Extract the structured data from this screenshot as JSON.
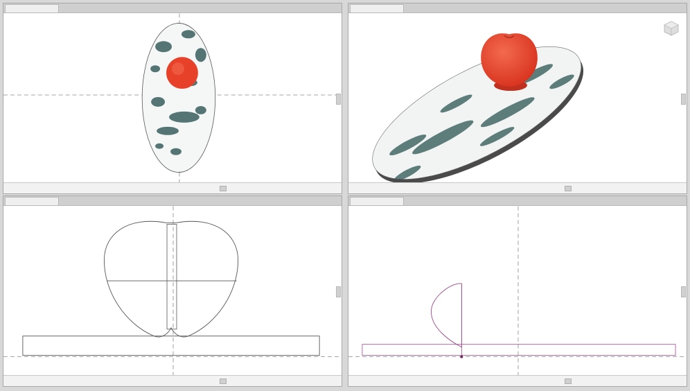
{
  "app": {
    "accent_color": "#e8412a"
  },
  "viewports": [
    {
      "id": "top",
      "tab_label": "",
      "status_tools": "",
      "status_end": ""
    },
    {
      "id": "perspective",
      "tab_label": "",
      "status_tools": "",
      "status_end": ""
    },
    {
      "id": "front",
      "tab_label": "",
      "status_tools": "",
      "status_end": ""
    },
    {
      "id": "right",
      "tab_label": "",
      "status_tools": "",
      "status_end": ""
    }
  ],
  "icons": {
    "nav_cube": "view-cube-icon"
  },
  "colors": {
    "apple": "#e8412a",
    "marble_dark": "#1f4a48",
    "wire": "#555555",
    "wire_selected": "#9a4a8a",
    "grid_axis": "#888888"
  }
}
